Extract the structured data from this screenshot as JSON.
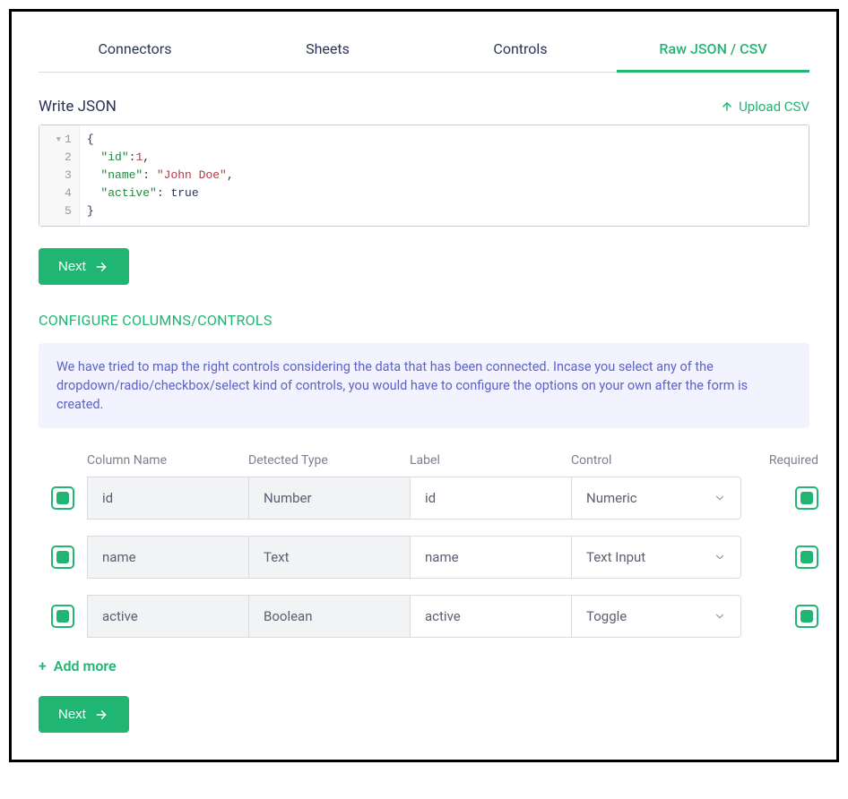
{
  "tabs": {
    "connectors": "Connectors",
    "sheets": "Sheets",
    "controls": "Controls",
    "raw": "Raw JSON / CSV"
  },
  "write_json_label": "Write JSON",
  "upload_csv_label": "Upload CSV",
  "code": {
    "line1_open": "{",
    "line2_key": "\"id\"",
    "line2_colon": ":",
    "line2_val": "1",
    "line2_comma": ",",
    "line3_key": "\"name\"",
    "line3_colon": ": ",
    "line3_val": "\"John Doe\"",
    "line3_comma": ",",
    "line4_key": "\"active\"",
    "line4_colon": ": ",
    "line4_val": "true",
    "line5_close": "}",
    "ln1": "1",
    "ln2": "2",
    "ln3": "3",
    "ln4": "4",
    "ln5": "5"
  },
  "next_label": "Next",
  "configure_heading": "CONFIGURE COLUMNS/CONTROLS",
  "info_text": "We have tried to map the right controls considering the data that has been connected. Incase you select any of the dropdown/radio/checkbox/select kind of controls, you would have to configure the options on your own after the form is created.",
  "headers": {
    "column_name": "Column Name",
    "detected_type": "Detected Type",
    "label": "Label",
    "control": "Control",
    "required": "Required"
  },
  "rows": [
    {
      "column_name": "id",
      "detected_type": "Number",
      "label": "id",
      "control": "Numeric"
    },
    {
      "column_name": "name",
      "detected_type": "Text",
      "label": "name",
      "control": "Text Input"
    },
    {
      "column_name": "active",
      "detected_type": "Boolean",
      "label": "active",
      "control": "Toggle"
    }
  ],
  "add_more_label": "Add more"
}
